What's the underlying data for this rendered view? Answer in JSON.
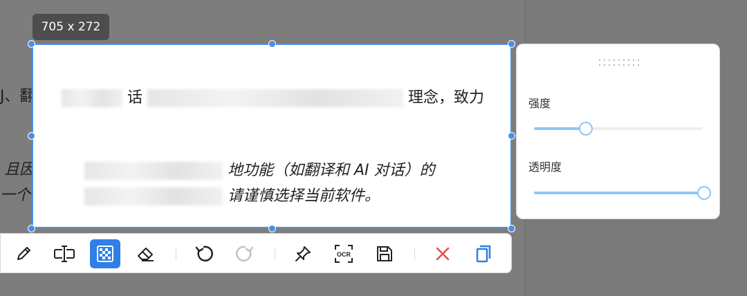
{
  "size_badge": "705 x 272",
  "document": {
    "outside_line1_left": "J、翻译",
    "outside_line2_left": "且因为尚",
    "outside_line3_left": "一个稳定的",
    "sel_line1": {
      "a": "话",
      "b": "理念，致力"
    },
    "sel_line2": {
      "a": "地功能（如翻译和 AI 对话）的"
    },
    "sel_line3": {
      "a": "请谨慎选择当前软件。"
    }
  },
  "toolbar": {
    "tools": [
      {
        "icon": "pencil-icon",
        "name": "pencil"
      },
      {
        "icon": "text-cursor-icon",
        "name": "text"
      },
      {
        "icon": "mosaic-icon",
        "name": "mosaic",
        "active": true
      },
      {
        "icon": "eraser-icon",
        "name": "eraser"
      },
      {
        "icon": "undo-icon",
        "name": "undo"
      },
      {
        "icon": "redo-icon",
        "name": "redo",
        "disabled": true
      },
      {
        "icon": "pin-icon",
        "name": "pin"
      },
      {
        "icon": "ocr-icon",
        "name": "ocr"
      },
      {
        "icon": "save-icon",
        "name": "save"
      },
      {
        "icon": "close-icon",
        "name": "cancel"
      },
      {
        "icon": "copy-icon",
        "name": "copy"
      }
    ],
    "ocr_label": "OCR"
  },
  "panel": {
    "strength_label": "强度",
    "strength_value": 0.3,
    "opacity_label": "透明度",
    "opacity_value": 1.0
  },
  "colors": {
    "accent": "#2f7fe6",
    "selection_border": "#4a90e2",
    "slider": "#8ec6f5",
    "cancel": "#e84a4a"
  }
}
